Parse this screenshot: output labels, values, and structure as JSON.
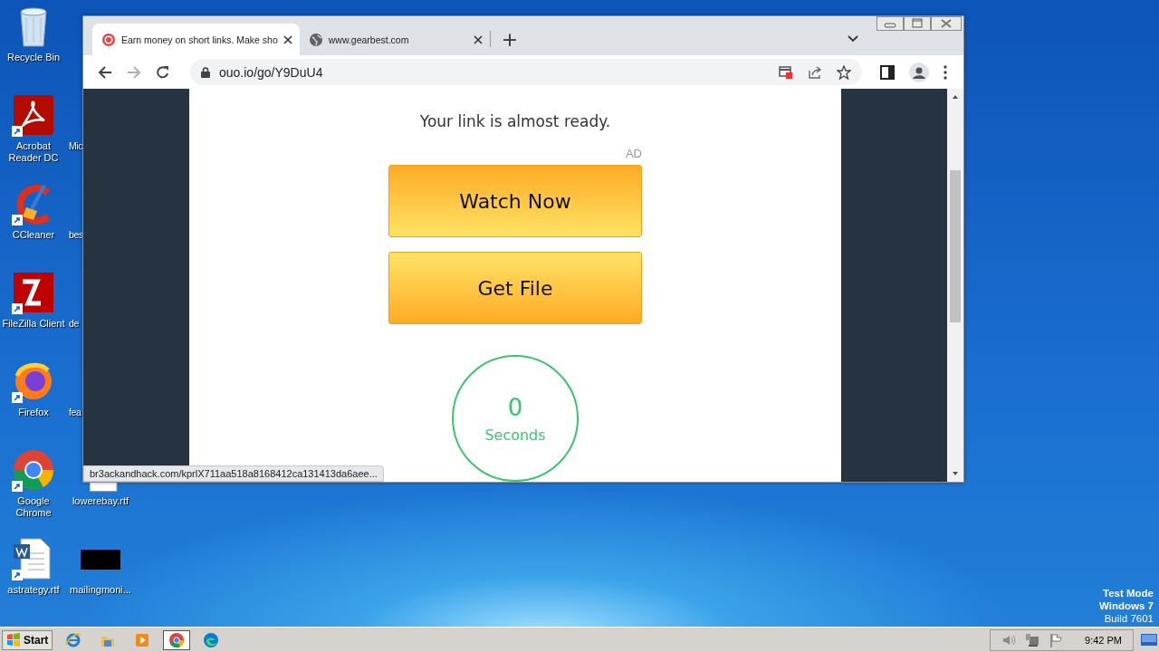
{
  "desktop": {
    "icons": [
      {
        "label": "Recycle Bin",
        "kind": "recycle"
      },
      {
        "label": "Acrobat Reader DC",
        "kind": "pdf"
      },
      {
        "label": "CCleaner",
        "kind": "ccleaner"
      },
      {
        "label": "FileZilla Client",
        "kind": "filezilla"
      },
      {
        "label": "Firefox",
        "kind": "firefox"
      },
      {
        "label": "Google Chrome",
        "kind": "chrome"
      },
      {
        "label": "astrategy.rtf",
        "kind": "word"
      }
    ],
    "icons_column_2": [
      {
        "label": "Mic"
      },
      {
        "label": "bes"
      },
      {
        "label": "de"
      },
      {
        "label": "fea"
      },
      {
        "label": "lowerebay.rtf",
        "kind": "doc"
      },
      {
        "label": "mailingmoni...",
        "kind": "black"
      }
    ],
    "system_notice": [
      "Test Mode",
      "Windows 7",
      "Build 7601"
    ]
  },
  "browser": {
    "tabs": [
      {
        "title": "Earn money on short links. Make sho",
        "kind": "target",
        "selected": true
      },
      {
        "title": "www.gearbest.com",
        "kind": "globe",
        "selected": false
      }
    ],
    "new_tab": "+",
    "address": "ouo.io/go/Y9DuU4",
    "page": {
      "heading": "Your link is almost ready.",
      "ad_label": "AD",
      "buttons": [
        {
          "label": "Watch Now",
          "kind": "down"
        },
        {
          "label": "Get File",
          "kind": "up"
        }
      ],
      "countdown": {
        "value": "0",
        "unit": "Seconds"
      }
    },
    "status_url": "br3ackandhack.com/kprlX711aa518a8168412ca131413da6aee..."
  },
  "taskbar": {
    "start": "Start",
    "apps": [
      {
        "kind": "ie",
        "selected": false
      },
      {
        "kind": "folder",
        "selected": false
      },
      {
        "kind": "media",
        "selected": false
      },
      {
        "kind": "chrome",
        "selected": true
      },
      {
        "kind": "edge",
        "selected": false
      }
    ],
    "clock": "9:42 PM"
  }
}
